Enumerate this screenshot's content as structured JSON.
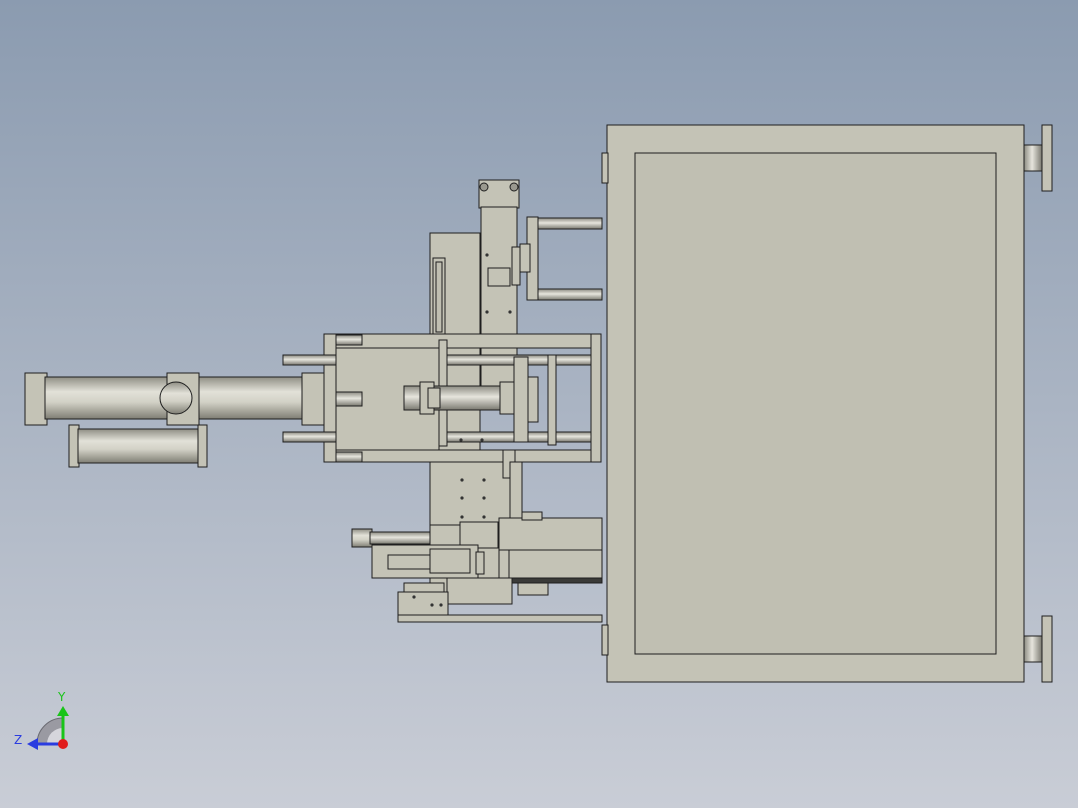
{
  "view": {
    "background_top": "#8b9bb0",
    "background_bottom": "#c9cdd6",
    "part_fill": "#c4c3b6",
    "edge_color": "#1e1e1e"
  },
  "triad": {
    "y_label": "Y",
    "z_label": "Z",
    "y_color": "#19c419",
    "z_color": "#2a3ce0",
    "x_color": "#e01c1c"
  }
}
